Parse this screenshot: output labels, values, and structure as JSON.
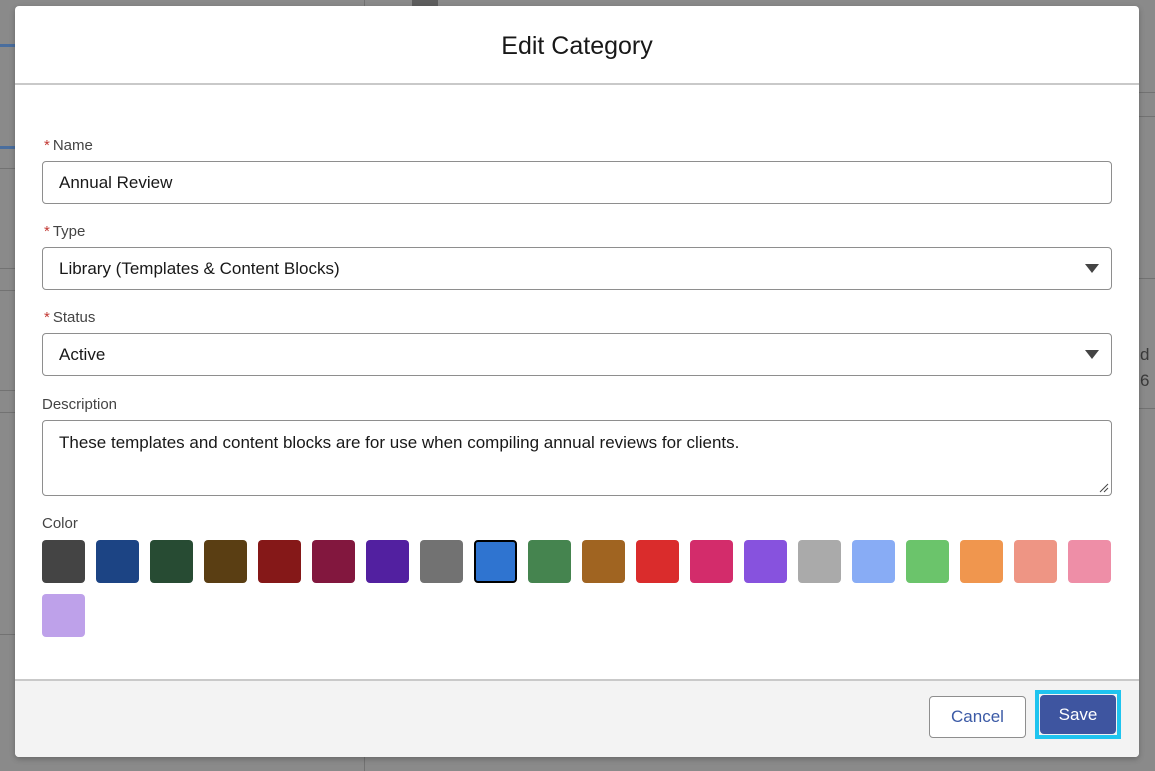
{
  "background": {
    "partial_text": [
      "d",
      "6"
    ]
  },
  "modal": {
    "title": "Edit Category",
    "required_marker": "*",
    "name_field": {
      "label": "Name",
      "value": "Annual Review"
    },
    "type_field": {
      "label": "Type",
      "value": "Library (Templates & Content Blocks)",
      "icon": "chevron-down-icon"
    },
    "status_field": {
      "label": "Status",
      "value": "Active",
      "icon": "chevron-down-icon"
    },
    "description_field": {
      "label": "Description",
      "value": "These templates and content blocks are for use when compiling annual reviews for clients."
    },
    "color_field": {
      "label": "Color",
      "selected_index": 8,
      "swatches": [
        "#444444",
        "#1c4484",
        "#274b33",
        "#5a3e13",
        "#851818",
        "#82173e",
        "#5220a0",
        "#727272",
        "#2f74d0",
        "#45844f",
        "#a06421",
        "#da2c2c",
        "#d32c6b",
        "#8752de",
        "#aaaaaa",
        "#88acf5",
        "#6bc46b",
        "#f0964e",
        "#ee9584",
        "#ee8ea7",
        "#bea1ea"
      ]
    },
    "footer": {
      "cancel_label": "Cancel",
      "save_label": "Save"
    }
  }
}
